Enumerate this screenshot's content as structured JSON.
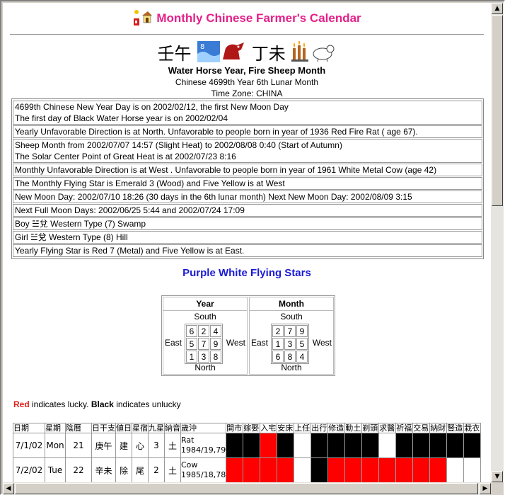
{
  "header": {
    "title": "Monthly Chinese Farmer's Calendar",
    "logo_icon": "farmer-house-icon"
  },
  "year_month": {
    "year_chars": "壬午",
    "year_icon": "water-horse-icon",
    "month_chars": "丁未",
    "month_icon": "fire-sheep-icon",
    "heading": "Water Horse Year, Fire Sheep Month",
    "lunar": "Chinese 4699th Year 6th Lunar Month",
    "timezone": "Time Zone: CHINA"
  },
  "info_rows": [
    {
      "lines": [
        "4699th Chinese New Year Day is on 2002/02/12, the first New Moon Day",
        "The first day of Black Water Horse year is on 2002/02/04"
      ]
    },
    {
      "lines": [
        "Yearly Unfavorable Direction is at North. Unfavorable to people born in year of 1936 Red Fire Rat ( age 67)."
      ]
    },
    {
      "lines": [
        "Sheep Month from 2002/07/07 14:57 (Slight Heat) to 2002/08/08 0:40 (Start of Autumn)",
        "The Solar Center Point of Great Heat is at 2002/07/23 8:16"
      ]
    },
    {
      "lines": [
        "Monthly Unfavorable Direction is at West . Unfavorable to people born in year of 1961 White Metal Cow (age 42)"
      ]
    },
    {
      "lines": [
        "The Monthly Flying Star is Emerald 3 (Wood) and Five Yellow is at West"
      ]
    },
    {
      "lines": [
        "New Moon Day: 2002/07/10 18:26 (30 days in the 6th lunar month) Next New Moon Day: 2002/08/09 3:15"
      ]
    },
    {
      "lines": [
        "Next Full Moon Days: 2002/06/25 5:44 and 2002/07/24 17:09"
      ]
    },
    {
      "lines": [
        "Boy ☱兌 Western Type (7) Swamp"
      ]
    },
    {
      "lines": [
        "Girl ☱兌 Western Type (8) Hill"
      ]
    },
    {
      "lines": [
        "Yearly Flying Star is Red 7 (Metal) and Five Yellow is at East."
      ]
    }
  ],
  "flying_stars": {
    "title": "Purple White Flying Stars",
    "year": {
      "label": "Year",
      "grid": [
        "6",
        "2",
        "4",
        "5",
        "7",
        "9",
        "1",
        "3",
        "8"
      ]
    },
    "month": {
      "label": "Month",
      "grid": [
        "2",
        "7",
        "9",
        "1",
        "3",
        "5",
        "6",
        "8",
        "4"
      ]
    },
    "south": "South",
    "north": "North",
    "east": "East",
    "west": "West"
  },
  "legend": {
    "red_word": "Red",
    "red_text": " indicates lucky. ",
    "black_word": "Black",
    "black_text": " indicates unlucky"
  },
  "calendar": {
    "headers": [
      "日期",
      "星期",
      "陰曆",
      "日干支",
      "値日",
      "星宿",
      "九星",
      "納音",
      "歲沖"
    ],
    "activity_headers": [
      "開市",
      "嫁娶",
      "入宅",
      "安床",
      "上任",
      "出行",
      "修造",
      "動土",
      "剃頭",
      "求醫",
      "祈福",
      "交易",
      "納財",
      "豎造",
      "栽衣"
    ],
    "rows": [
      {
        "date": "7/1/02",
        "weekday": "Mon",
        "lunar": "21",
        "ganzhi": "庚午",
        "zhi": "建",
        "xiu": "心",
        "star": "3",
        "nayin": "土",
        "clash_animal": "Rat",
        "clash_years": "1984/19,79",
        "activities": [
          "b",
          "b",
          "r",
          "b",
          "w",
          "b",
          "b",
          "b",
          "b",
          "w",
          "b",
          "b",
          "b",
          "b",
          "b"
        ]
      },
      {
        "date": "7/2/02",
        "weekday": "Tue",
        "lunar": "22",
        "ganzhi": "辛未",
        "zhi": "除",
        "xiu": "尾",
        "star": "2",
        "nayin": "土",
        "clash_animal": "Cow",
        "clash_years": "1985/18,78",
        "activities": [
          "r",
          "r",
          "r",
          "r",
          "w",
          "b",
          "r",
          "r",
          "r",
          "r",
          "r",
          "r",
          "r",
          "w",
          "w"
        ]
      }
    ]
  },
  "colors": {
    "title": "#e5208a",
    "stars_title": "#1a1ad6",
    "lucky": "#ff0000",
    "unlucky": "#000000"
  }
}
